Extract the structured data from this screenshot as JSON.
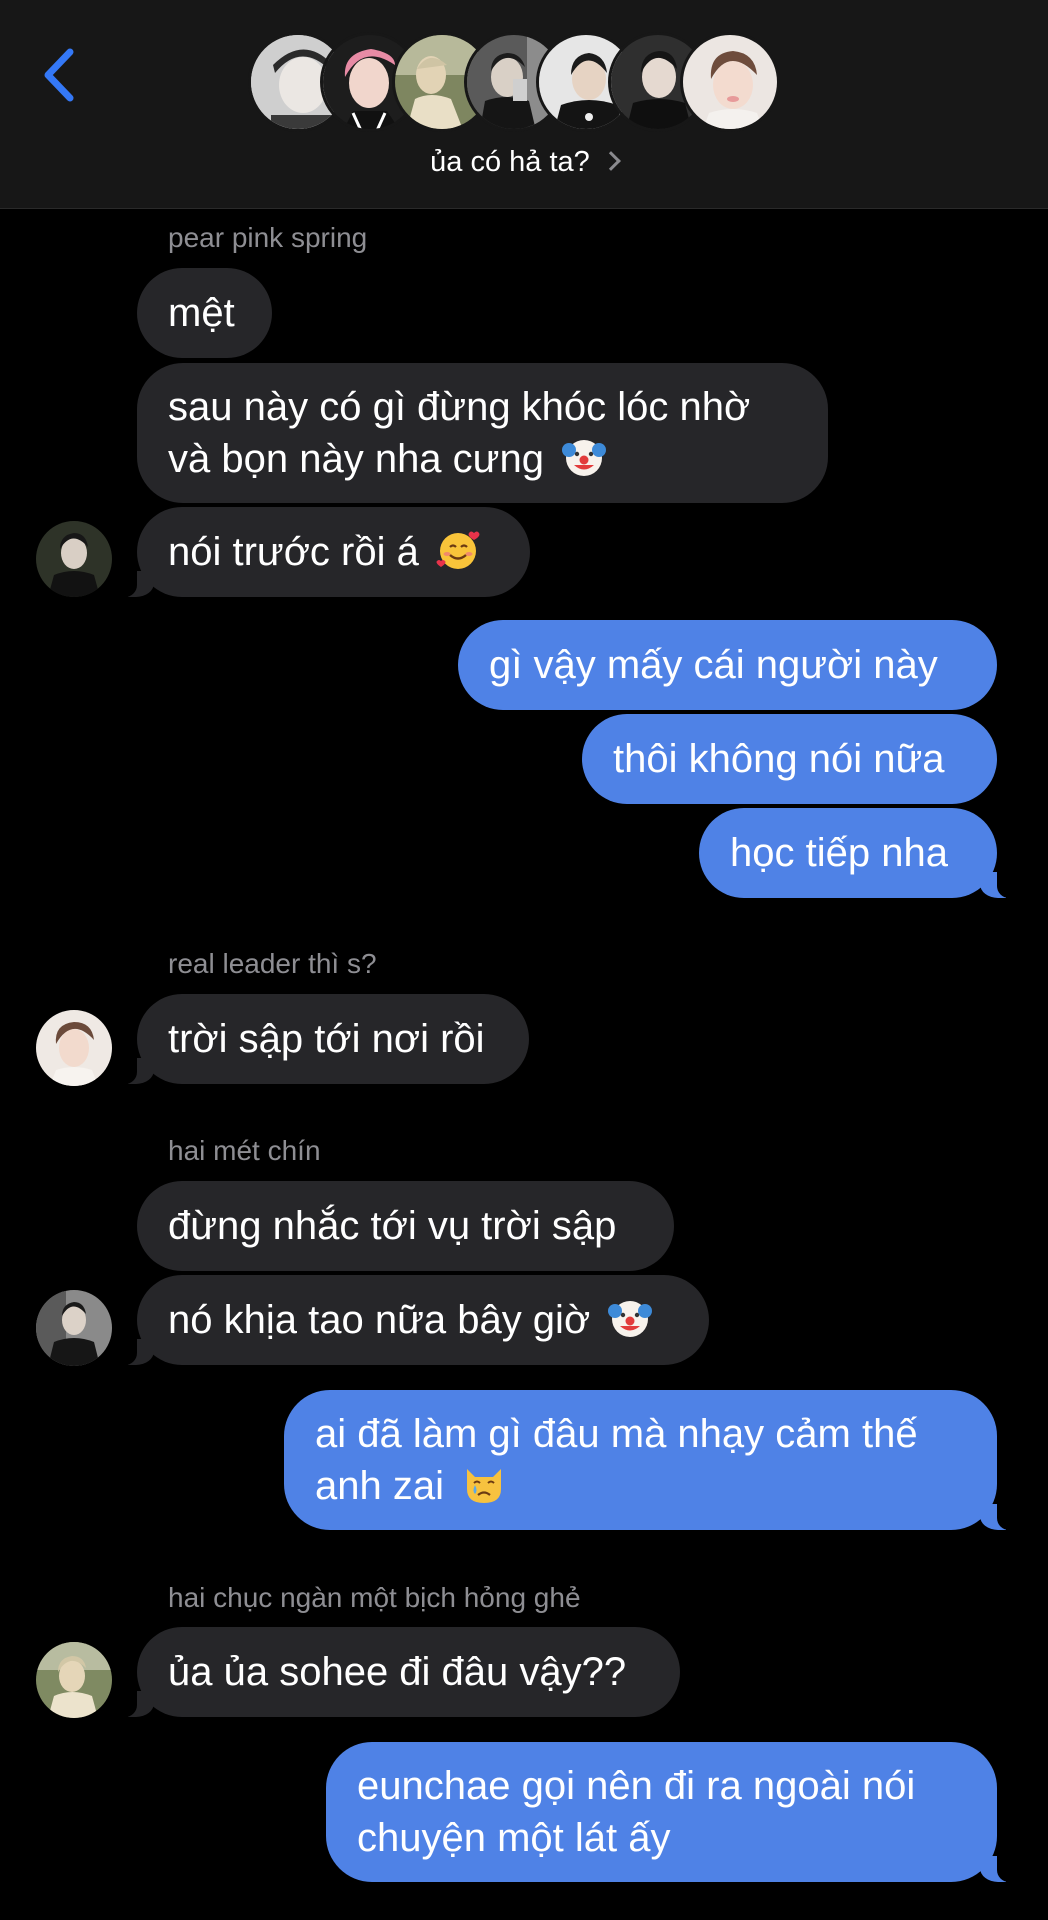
{
  "header": {
    "group_name": "ủa có hả ta?",
    "back_icon": "chevron-left-icon",
    "accent_color": "#3478f6",
    "participant_avatars": [
      {
        "name": "avatar-1",
        "bg": "#d9d9d9",
        "skin": "#e8e3de",
        "hair": "#2a2a2a"
      },
      {
        "name": "avatar-2",
        "bg": "#1a1a1a",
        "skin": "#f0d0c8",
        "hair": "#e98aa3"
      },
      {
        "name": "avatar-3",
        "bg": "#8a8f6a",
        "skin": "#e5d6b8",
        "hair": "#c9bfa0"
      },
      {
        "name": "avatar-4",
        "bg": "#6a6a6a",
        "skin": "#d8cfc5",
        "hair": "#1e1e1e"
      },
      {
        "name": "avatar-5",
        "bg": "#e5e5e5",
        "skin": "#e6d2c2",
        "hair": "#1b1b1b"
      },
      {
        "name": "avatar-6",
        "bg": "#3a3a3a",
        "skin": "#e7dbd2",
        "hair": "#151515"
      },
      {
        "name": "avatar-7",
        "bg": "#e9e4e0",
        "skin": "#f2d9cc",
        "hair": "#6b4a3a"
      }
    ]
  },
  "messages": {
    "s1": "pear pink spring",
    "m1": "mệt",
    "m2a": "sau này có gì đừng khóc lóc nhờ",
    "m2b": "và bọn này nha cưng",
    "m3": "nói trước rồi á",
    "m4": "gì vậy mấy cái người này",
    "m5": "thôi không nói nữa",
    "m6": "học tiếp nha",
    "s2": "real leader thì s?",
    "m7": "trời sập tới nơi rồi",
    "s3": "hai mét chín",
    "m8": "đừng nhắc tới vụ trời sập",
    "m9": "nó khịa tao nữa bây giờ",
    "m10a": "ai đã làm gì đâu mà nhạy cảm thế",
    "m10b": "anh zai",
    "s4": "hai chục ngàn một bịch hỏng ghẻ",
    "m11": "ủa ủa sohee đi đâu vậy??",
    "m12a": "eunchae gọi nên đi ra ngoài nói",
    "m12b": "chuyện một lát ấy"
  },
  "emojis": {
    "clown": "clown-face-emoji",
    "smiling_hearts": "smiling-face-with-hearts-emoji",
    "crying_cat": "crying-cat-emoji"
  },
  "colors": {
    "incoming_bubble": "#262629",
    "outgoing_bubble": "#4f82e6",
    "sender_label": "#8e8e93",
    "header_bg": "#171717"
  }
}
